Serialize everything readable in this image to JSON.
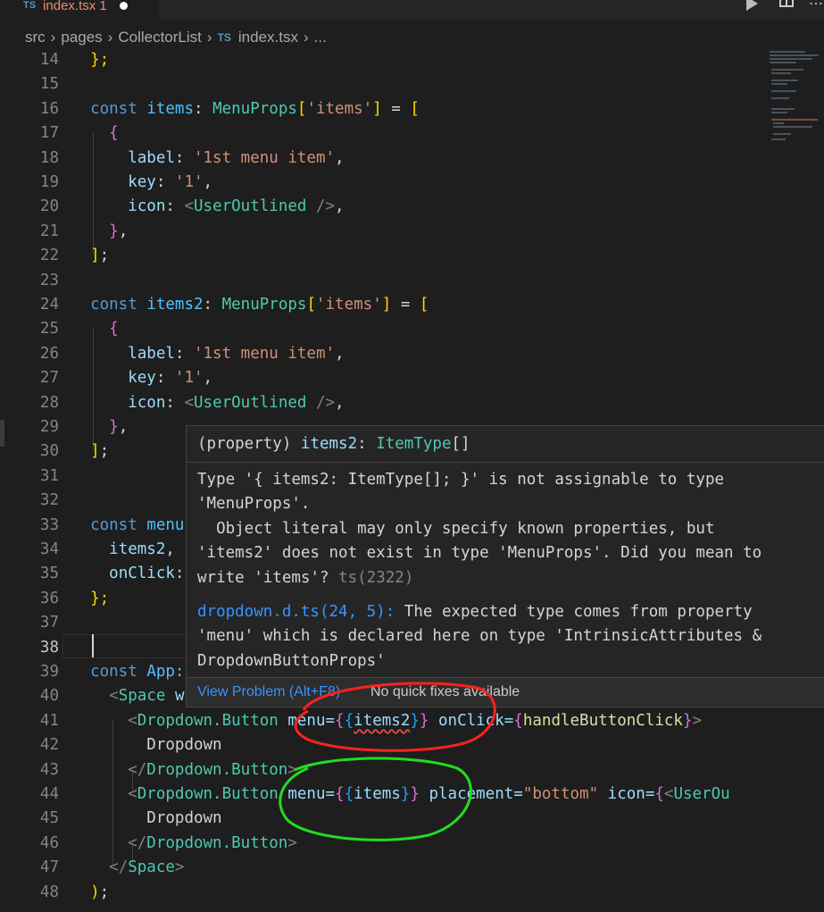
{
  "tab": {
    "badge": "TS",
    "filename": "index.tsx 1"
  },
  "breadcrumb": {
    "parts": [
      "src",
      "pages",
      "CollectorList"
    ],
    "ts_badge": "TS",
    "file": "index.tsx",
    "ellipsis": "..."
  },
  "lines": [
    "14",
    "15",
    "16",
    "17",
    "18",
    "19",
    "20",
    "21",
    "22",
    "23",
    "24",
    "25",
    "26",
    "27",
    "28",
    "29",
    "30",
    "31",
    "32",
    "33",
    "34",
    "35",
    "36",
    "37",
    "38",
    "39",
    "40",
    "41",
    "42",
    "43",
    "44",
    "45",
    "46",
    "47",
    "48"
  ],
  "code": {
    "l14": "};",
    "const": "const",
    "items": "items",
    "items2": "items2",
    "MenuProps": "MenuProps",
    "items_str": "'items'",
    "label": "label",
    "key": "key",
    "icon": "icon",
    "label_val": "'1st menu item'",
    "key_val": "'1'",
    "UserOutlined": "UserOutlined",
    "menu_partial": "menu",
    "onClick": "onClick:",
    "App_partial": "App:",
    "Space": "Space",
    "Space_partial": "w",
    "DropdownButton": "Dropdown.Button",
    "menu_attr": "menu=",
    "onClick_attr": "onClick=",
    "handleButtonClick": "handleButtonClick",
    "Dropdown": "Dropdown",
    "placement_attr": "placement=",
    "bottom": "\"bottom\"",
    "icon_attr": "icon=",
    "UserOu": "UserOu"
  },
  "hover": {
    "signature": "(property) items2: ItemType[]",
    "message_lines": [
      "Type '{ items2: ItemType[]; }' is not assignable to type",
      "'MenuProps'.",
      "  Object literal may only specify known properties, but",
      "'items2' does not exist in type 'MenuProps'. Did you mean to",
      "write 'items'?"
    ],
    "error_code": "ts(2322)",
    "source_link": "dropdown.d.ts(24, 5):",
    "source_lines": [
      " The expected type comes from property",
      "'menu' which is declared here on type 'IntrinsicAttributes &",
      "DropdownButtonProps'"
    ],
    "view_problem": "View Problem (Alt+F8)",
    "no_fixes": "No quick fixes available"
  },
  "annotations": {
    "red_circle_color": "#ff2020",
    "green_circle_color": "#22dd22"
  },
  "colors": {
    "background": "#1e1e1e",
    "keyword": "#569cd6",
    "type": "#4ec9b0",
    "string": "#ce9178",
    "property": "#9cdcfe",
    "error": "#f48771"
  }
}
